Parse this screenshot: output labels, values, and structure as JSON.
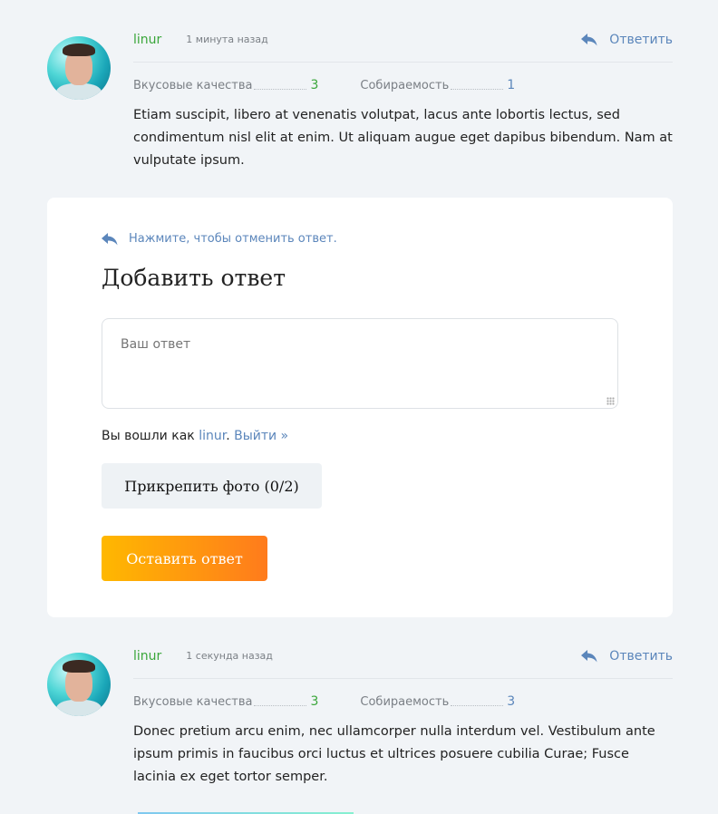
{
  "comments": [
    {
      "author": "linur",
      "time": "1 минута назад",
      "reply_label": "Ответить",
      "rating1_label": "Вкусовые качества",
      "rating1_value": "3",
      "rating2_label": "Собираемость",
      "rating2_value": "1",
      "text": "Etiam suscipit, libero at venenatis volutpat, lacus ante lobortis lectus, sed condimentum nisl elit at enim. Ut aliquam augue eget dapibus bibendum. Nam at vulputate ipsum."
    },
    {
      "author": "linur",
      "time": "1 секунда назад",
      "reply_label": "Ответить",
      "rating1_label": "Вкусовые качества",
      "rating1_value": "3",
      "rating2_label": "Собираемость",
      "rating2_value": "3",
      "text": "Donec pretium arcu enim, nec ullamcorper nulla interdum vel. Vestibulum ante ipsum primis in faucibus orci luctus et ultrices posuere cubilia Curae; Fusce lacinia ex eget tortor semper."
    }
  ],
  "reply_form": {
    "cancel_label": "Нажмите, чтобы отменить ответ.",
    "title": "Добавить ответ",
    "textarea_placeholder": "Ваш ответ",
    "logged_prefix": "Вы вошли как ",
    "logged_user": "linur",
    "logged_sep": ". ",
    "logout_label": "Выйти »",
    "attach_label": "Прикрепить фото (0/2)",
    "submit_label": "Оставить ответ"
  },
  "colors": {
    "author": "#3aa63a",
    "link": "#5b86bb",
    "submit_from": "#ffb800",
    "submit_to": "#ff7b1c"
  },
  "icons": {
    "reply": "reply-arrow-icon",
    "avatar": "user-avatar"
  }
}
